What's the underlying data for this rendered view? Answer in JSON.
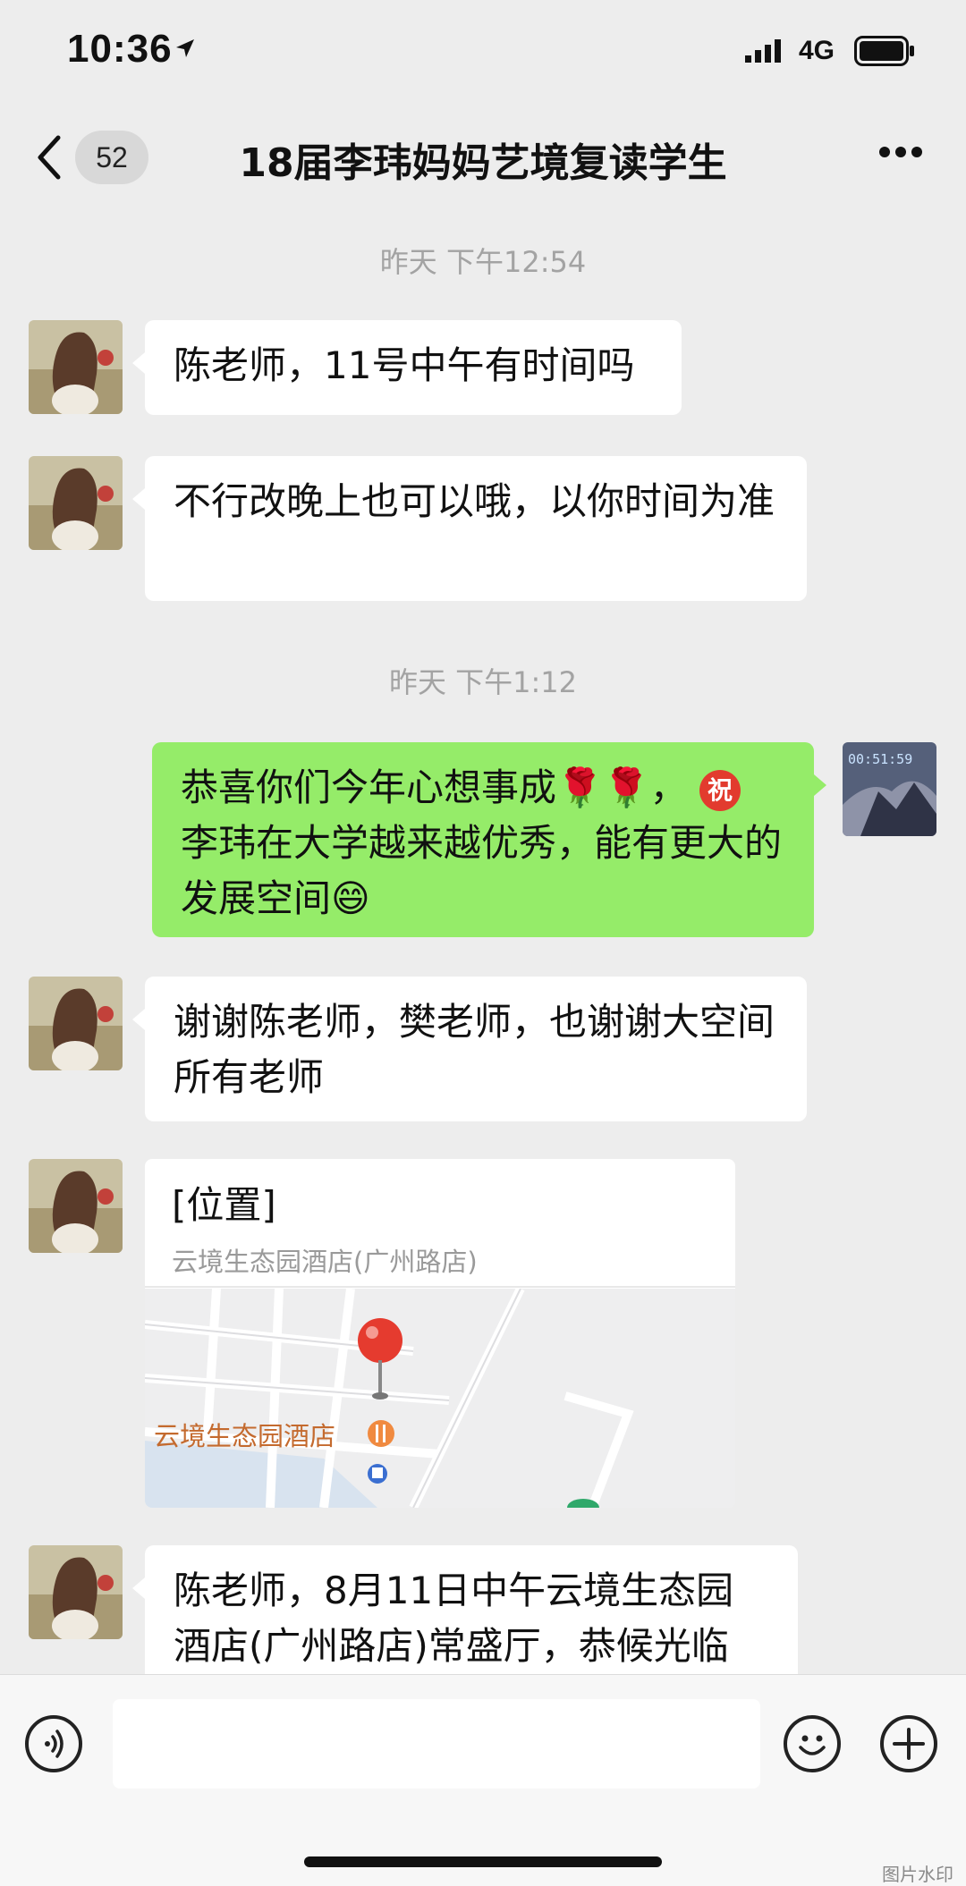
{
  "status_bar": {
    "time": "10:36",
    "network": "4G"
  },
  "nav": {
    "badge": "52",
    "title": "18届李玮妈妈艺境复读学生"
  },
  "messages": [
    {
      "type": "timestamp",
      "text": "昨天 下午12:54"
    },
    {
      "type": "text",
      "side": "left",
      "text": "陈老师，11号中午有时间吗"
    },
    {
      "type": "text",
      "side": "left",
      "text": "不行改晚上也可以哦，以你时间为准"
    },
    {
      "type": "timestamp",
      "text": "昨天 下午1:12"
    },
    {
      "type": "text",
      "side": "right",
      "text_before": "恭喜你们今年心想事成",
      "emoji_flowers": "🌹🌹",
      "comma": "，",
      "chip": "祝",
      "text_after": "李玮在大学越来越优秀，能有更大的发展空间",
      "emoji_end": "😄"
    },
    {
      "type": "text",
      "side": "left",
      "text": "谢谢陈老师，樊老师，也谢谢大空间所有老师"
    },
    {
      "type": "location",
      "side": "left",
      "title": "[位置]",
      "address": "云境生态园酒店(广州路店)",
      "map_label": "云境生态园酒店"
    },
    {
      "type": "text",
      "side": "left",
      "text": "陈老师，8月11日中午云境生态园酒店(广州路店)常盛厅，恭候光临"
    }
  ],
  "self_avatar_clock": "00:51:59",
  "input_bar": {
    "voice_icon": "voice-icon",
    "emoji_icon": "emoji-icon",
    "add_icon": "plus-icon"
  },
  "watermark": "图片水印",
  "colors": {
    "background": "#ededed",
    "self_bubble": "#95ec69",
    "other_bubble": "#ffffff",
    "map_pin": "#e53b2f"
  }
}
